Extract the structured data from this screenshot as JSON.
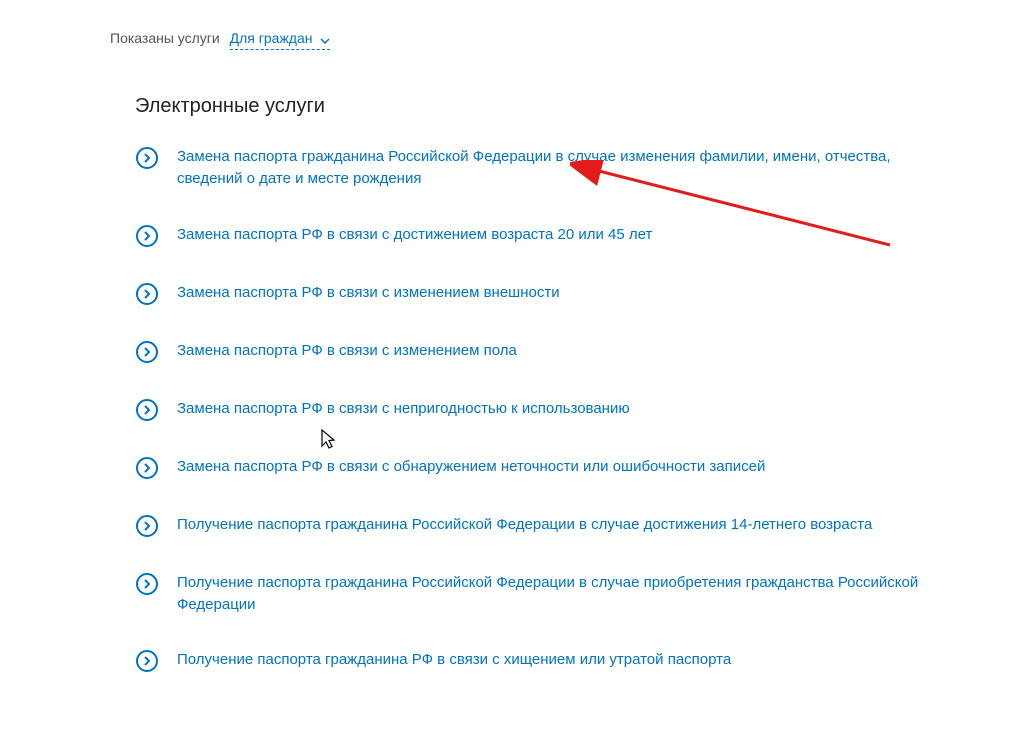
{
  "filter": {
    "label": "Показаны услуги",
    "selected": "Для граждан"
  },
  "section": {
    "heading": "Электронные услуги"
  },
  "services": [
    {
      "text": "Замена паспорта гражданина Российской Федерации в случае изменения фамилии, имени, отчества, сведений о дате и месте рождения"
    },
    {
      "text": "Замена паспорта РФ в связи с достижением возраста 20 или 45 лет"
    },
    {
      "text": "Замена паспорта РФ в связи с изменением внешности"
    },
    {
      "text": "Замена паспорта РФ в связи с изменением пола"
    },
    {
      "text": "Замена паспорта РФ в связи с непригодностью к использованию"
    },
    {
      "text": "Замена паспорта РФ в связи с обнаружением неточности или ошибочности записей"
    },
    {
      "text": "Получение паспорта гражданина Российской Федерации в случае достижения 14-летнего возраста"
    },
    {
      "text": "Получение паспорта гражданина Российской Федерации в случае приобретения гражданства Российской Федерации"
    },
    {
      "text": "Получение паспорта гражданина РФ в связи с хищением или утратой паспорта"
    }
  ],
  "colors": {
    "link": "#0173c1",
    "heading": "#222222",
    "filter_text": "#555555",
    "arrow": "#e21b1b"
  }
}
